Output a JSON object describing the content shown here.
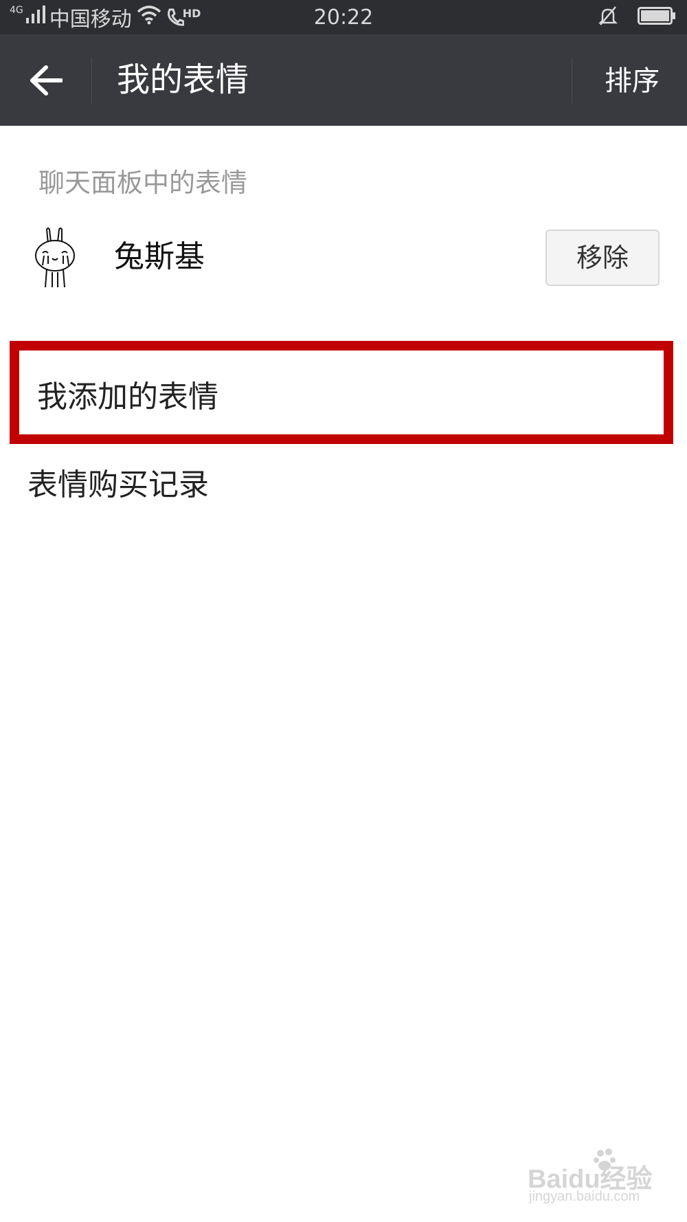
{
  "status_bar": {
    "network_type": "4G",
    "carrier": "中国移动",
    "hd_label": "HD",
    "time": "20:22"
  },
  "app_bar": {
    "title": "我的表情",
    "sort_label": "排序"
  },
  "chat_panel": {
    "header": "聊天面板中的表情",
    "stickers": [
      {
        "name": "兔斯基",
        "action_label": "移除"
      }
    ]
  },
  "menu": {
    "items": [
      {
        "label": "我添加的表情",
        "highlighted": true
      },
      {
        "label": "表情购买记录",
        "highlighted": false
      }
    ]
  },
  "watermark": {
    "brand": "Baidu经验",
    "url": "jingyan.baidu.com"
  },
  "colors": {
    "status_bar_bg": "#2d2e32",
    "app_bar_bg": "#393a3f",
    "highlight_border": "#c10000"
  }
}
